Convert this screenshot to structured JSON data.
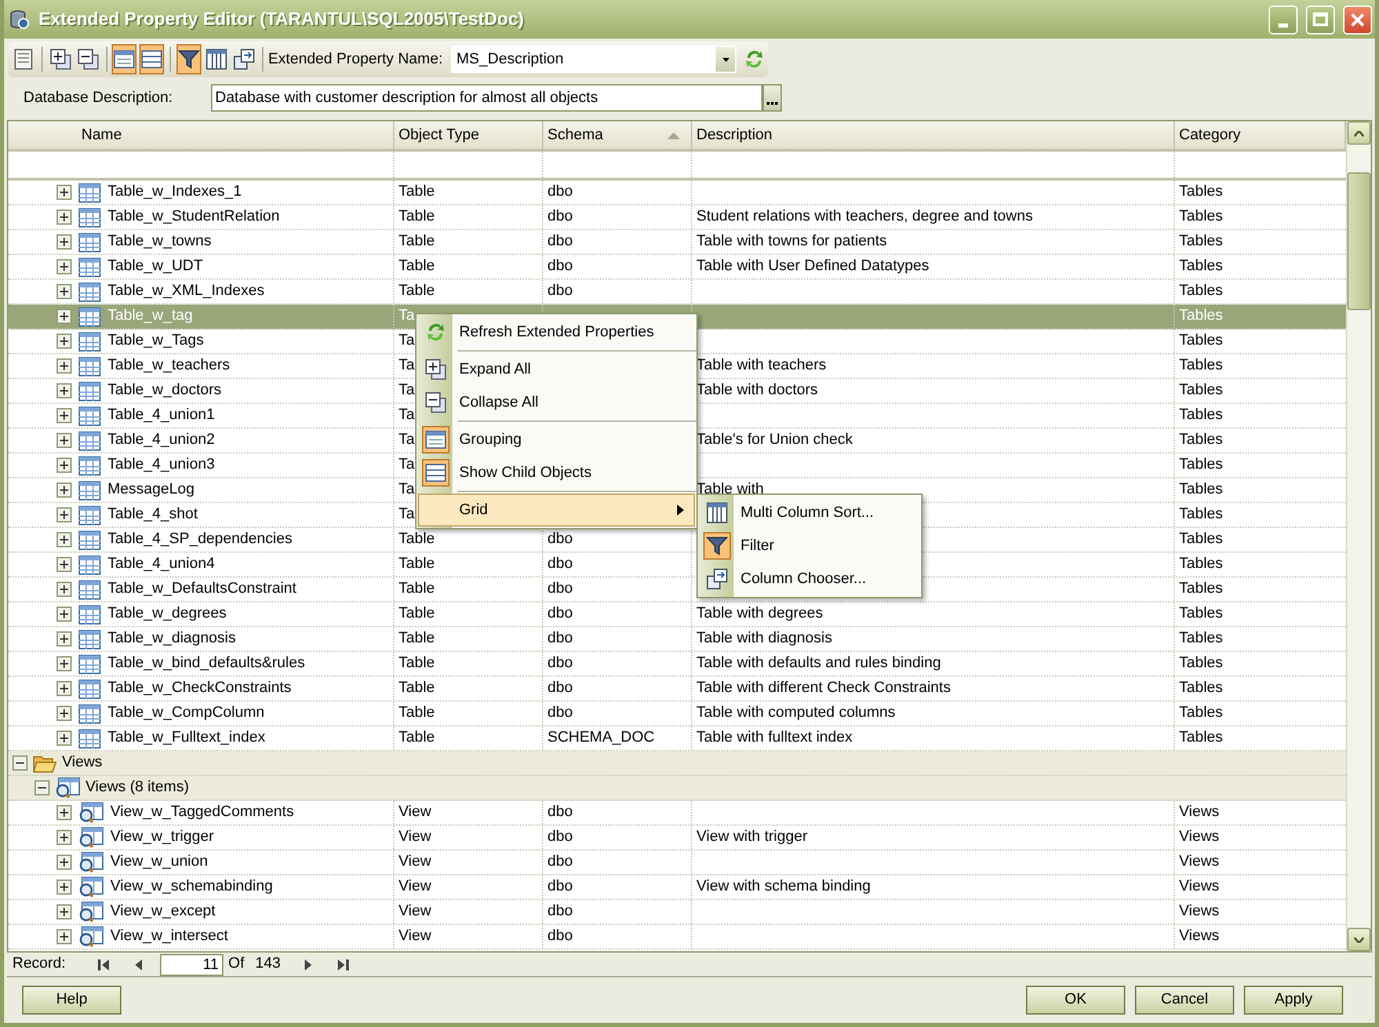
{
  "window": {
    "title": "Extended Property Editor (TARANTUL\\SQL2005\\TestDoc)"
  },
  "toolbar": {
    "groups": [
      [
        {
          "kind": "properties",
          "selected": false
        }
      ],
      [
        {
          "kind": "expand_all",
          "selected": false
        },
        {
          "kind": "collapse_all",
          "selected": false
        }
      ],
      [
        {
          "kind": "grouping",
          "selected": true
        },
        {
          "kind": "child_objects",
          "selected": true
        }
      ],
      [
        {
          "kind": "filter",
          "selected": true
        },
        {
          "kind": "sort",
          "selected": false
        },
        {
          "kind": "column_chooser",
          "selected": false
        }
      ]
    ],
    "property_label": "Extended Property Name:",
    "property_value": "MS_Description"
  },
  "database_description": {
    "label": "Database Description:",
    "value": "Database with customer description for almost all objects"
  },
  "grid": {
    "columns": [
      {
        "label": "Name",
        "sorted": false
      },
      {
        "label": "Object Type",
        "sorted": false
      },
      {
        "label": "Schema",
        "sorted": true
      },
      {
        "label": "Description",
        "sorted": false
      },
      {
        "label": "Category",
        "sorted": false
      }
    ],
    "rows": [
      {
        "kind": "table",
        "name": "Table_w_Indexes_1",
        "object_type": "Table",
        "schema": "dbo",
        "category": "Tables",
        "expanded": false,
        "selected": false
      },
      {
        "kind": "table",
        "name": "Table_w_StudentRelation",
        "object_type": "Table",
        "schema": "dbo",
        "description": "Student relations with teachers, degree and towns",
        "category": "Tables",
        "expanded": false,
        "selected": false
      },
      {
        "kind": "table",
        "name": "Table_w_towns",
        "object_type": "Table",
        "schema": "dbo",
        "description": "Table with towns for patients",
        "category": "Tables",
        "expanded": false,
        "selected": false
      },
      {
        "kind": "table",
        "name": "Table_w_UDT",
        "object_type": "Table",
        "schema": "dbo",
        "description": "Table with User Defined Datatypes",
        "category": "Tables",
        "expanded": false,
        "selected": false
      },
      {
        "kind": "table",
        "name": "Table_w_XML_Indexes",
        "object_type": "Table",
        "schema": "dbo",
        "category": "Tables",
        "expanded": false,
        "selected": false
      },
      {
        "kind": "table",
        "name": "Table_w_tag",
        "object_type": "Ta",
        "category": "Tables",
        "expanded": false,
        "selected": true
      },
      {
        "kind": "table",
        "name": "Table_w_Tags",
        "object_type": "Ta",
        "category": "Tables",
        "expanded": false,
        "selected": false
      },
      {
        "kind": "table",
        "name": "Table_w_teachers",
        "object_type": "Ta",
        "description": "Table with teachers",
        "category": "Tables",
        "expanded": false,
        "selected": false
      },
      {
        "kind": "table",
        "name": "Table_w_doctors",
        "object_type": "Ta",
        "description": "Table with doctors",
        "category": "Tables",
        "expanded": false,
        "selected": false
      },
      {
        "kind": "table",
        "name": "Table_4_union1",
        "object_type": "Ta",
        "category": "Tables",
        "expanded": false,
        "selected": false
      },
      {
        "kind": "table",
        "name": "Table_4_union2",
        "object_type": "Ta",
        "description": "Table's for Union check",
        "category": "Tables",
        "expanded": false,
        "selected": false
      },
      {
        "kind": "table",
        "name": "Table_4_union3",
        "object_type": "Ta",
        "category": "Tables",
        "expanded": false,
        "selected": false
      },
      {
        "kind": "table",
        "name": "MessageLog",
        "object_type": "Ta",
        "description": "Table with",
        "category": "Tables",
        "expanded": false,
        "selected": false
      },
      {
        "kind": "table",
        "name": "Table_4_shot",
        "object_type": "Ta",
        "category": "Tables",
        "expanded": false,
        "selected": false
      },
      {
        "kind": "table",
        "name": "Table_4_SP_dependencies",
        "object_type": "Table",
        "schema": "dbo",
        "category": "Tables",
        "expanded": false,
        "selected": false
      },
      {
        "kind": "table",
        "name": "Table_4_union4",
        "object_type": "Table",
        "schema": "dbo",
        "category": "Tables",
        "expanded": false,
        "selected": false
      },
      {
        "kind": "table",
        "name": "Table_w_DefaultsConstraint",
        "object_type": "Table",
        "schema": "dbo",
        "category": "Tables",
        "expanded": false,
        "selected": false
      },
      {
        "kind": "table",
        "name": "Table_w_degrees",
        "object_type": "Table",
        "schema": "dbo",
        "description": "Table with degrees",
        "category": "Tables",
        "expanded": false,
        "selected": false
      },
      {
        "kind": "table",
        "name": "Table_w_diagnosis",
        "object_type": "Table",
        "schema": "dbo",
        "description": "Table with diagnosis",
        "category": "Tables",
        "expanded": false,
        "selected": false
      },
      {
        "kind": "table",
        "name": "Table_w_bind_defaults&rules",
        "object_type": "Table",
        "schema": "dbo",
        "description": "Table with defaults and rules binding",
        "category": "Tables",
        "expanded": false,
        "selected": false
      },
      {
        "kind": "table",
        "name": "Table_w_CheckConstraints",
        "object_type": "Table",
        "schema": "dbo",
        "description": "Table with different Check Constraints",
        "category": "Tables",
        "expanded": false,
        "selected": false
      },
      {
        "kind": "table",
        "name": "Table_w_CompColumn",
        "object_type": "Table",
        "schema": "dbo",
        "description": "Table with computed columns",
        "category": "Tables",
        "expanded": false,
        "selected": false
      },
      {
        "kind": "table",
        "name": "Table_w_Fulltext_index",
        "object_type": "Table",
        "schema": "SCHEMA_DOC",
        "description": "Table with fulltext index",
        "category": "Tables",
        "expanded": false,
        "selected": false
      },
      {
        "kind": "group",
        "name": "Views",
        "expanded": true,
        "children": [
          {
            "kind": "subgroup",
            "name": "Views (8 items)",
            "expanded": true,
            "children": [
              {
                "kind": "view",
                "name": "View_w_TaggedComments",
                "object_type": "View",
                "schema": "dbo",
                "category": "Views",
                "expanded": false,
                "selected": false
              },
              {
                "kind": "view",
                "name": "View_w_trigger",
                "object_type": "View",
                "schema": "dbo",
                "description": "View with trigger",
                "category": "Views",
                "expanded": false,
                "selected": false
              },
              {
                "kind": "view",
                "name": "View_w_union",
                "object_type": "View",
                "schema": "dbo",
                "category": "Views",
                "expanded": false,
                "selected": false
              },
              {
                "kind": "view",
                "name": "View_w_schemabinding",
                "object_type": "View",
                "schema": "dbo",
                "description": "View with schema binding",
                "category": "Views",
                "expanded": false,
                "selected": false
              },
              {
                "kind": "view",
                "name": "View_w_except",
                "object_type": "View",
                "schema": "dbo",
                "category": "Views",
                "expanded": false,
                "selected": false
              },
              {
                "kind": "view",
                "name": "View_w_intersect",
                "object_type": "View",
                "schema": "dbo",
                "category": "Views",
                "expanded": false,
                "selected": false
              }
            ]
          }
        ]
      }
    ]
  },
  "context_menu": {
    "items": [
      {
        "kind": "refresh",
        "label": "Refresh Extended Properties",
        "checked": false,
        "selected": false
      },
      {
        "kind": "separator"
      },
      {
        "kind": "expand_all",
        "label": "Expand All",
        "checked": false,
        "selected": false
      },
      {
        "kind": "collapse_all",
        "label": "Collapse All",
        "checked": false,
        "selected": false
      },
      {
        "kind": "separator"
      },
      {
        "kind": "grouping",
        "label": "Grouping",
        "checked": true,
        "selected": false
      },
      {
        "kind": "child_objects",
        "label": "Show Child Objects",
        "checked": true,
        "selected": false
      },
      {
        "kind": "separator"
      },
      {
        "kind": "submenu",
        "label": "Grid",
        "selected": true
      }
    ]
  },
  "submenu": {
    "items": [
      {
        "kind": "sort",
        "label": "Multi Column Sort...",
        "checked": false
      },
      {
        "kind": "filter",
        "label": "Filter",
        "checked": true
      },
      {
        "kind": "column_chooser",
        "label": "Column Chooser...",
        "checked": false
      }
    ]
  },
  "record_bar": {
    "label": "Record:",
    "current": "11",
    "of_label": "Of",
    "total": "143"
  },
  "help_button": "Help",
  "buttons": [
    "OK",
    "Cancel",
    "Apply"
  ]
}
